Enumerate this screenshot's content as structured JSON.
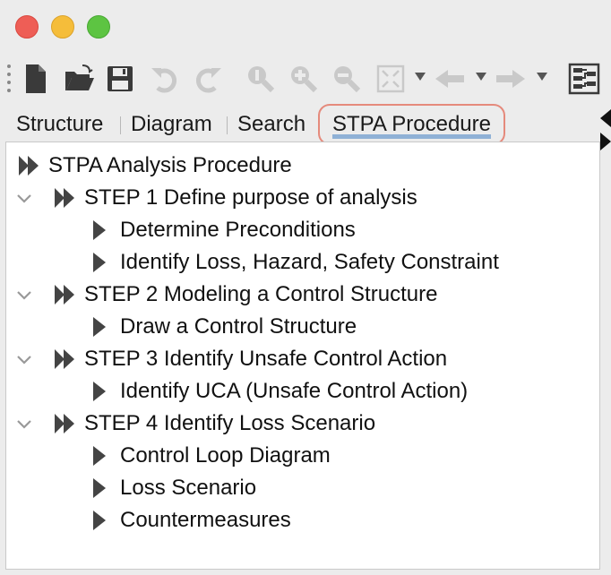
{
  "window": {
    "buttons": [
      "close",
      "minimize",
      "zoom"
    ]
  },
  "toolbar": {
    "items": [
      {
        "name": "new-file-icon",
        "enabled": true
      },
      {
        "name": "open-folder-icon",
        "enabled": true
      },
      {
        "name": "save-icon",
        "enabled": true
      },
      {
        "name": "undo-icon",
        "enabled": false
      },
      {
        "name": "redo-icon",
        "enabled": false
      },
      {
        "name": "zoom-reset-icon",
        "enabled": false
      },
      {
        "name": "zoom-in-icon",
        "enabled": false
      },
      {
        "name": "zoom-out-icon",
        "enabled": false
      },
      {
        "name": "fit-to-window-icon",
        "enabled": false
      },
      {
        "name": "back-icon",
        "enabled": false
      },
      {
        "name": "forward-icon",
        "enabled": false
      },
      {
        "name": "layout-icon",
        "enabled": true
      }
    ]
  },
  "tabs": [
    {
      "label": "Structure",
      "active": false
    },
    {
      "label": "Diagram",
      "active": false
    },
    {
      "label": "Search",
      "active": false
    },
    {
      "label": "STPA Procedure",
      "active": true
    }
  ],
  "tree": {
    "root": "STPA Analysis Procedure",
    "steps": [
      {
        "label": "STEP 1 Define purpose of analysis",
        "expanded": true,
        "children": [
          "Determine Preconditions",
          "Identify Loss, Hazard, Safety Constraint"
        ]
      },
      {
        "label": "STEP 2 Modeling a Control Structure",
        "expanded": true,
        "children": [
          "Draw a Control Structure"
        ]
      },
      {
        "label": "STEP 3 Identify Unsafe Control Action",
        "expanded": true,
        "children": [
          "Identify UCA (Unsafe Control Action)"
        ]
      },
      {
        "label": "STEP 4 Identify Loss Scenario",
        "expanded": true,
        "children": [
          "Control Loop Diagram",
          "Loss Scenario",
          "Countermeasures"
        ]
      }
    ]
  },
  "colors": {
    "active_tab_border": "#e58a7c",
    "active_tab_underline": "#8fb1d6",
    "panel_background": "#ffffff"
  }
}
